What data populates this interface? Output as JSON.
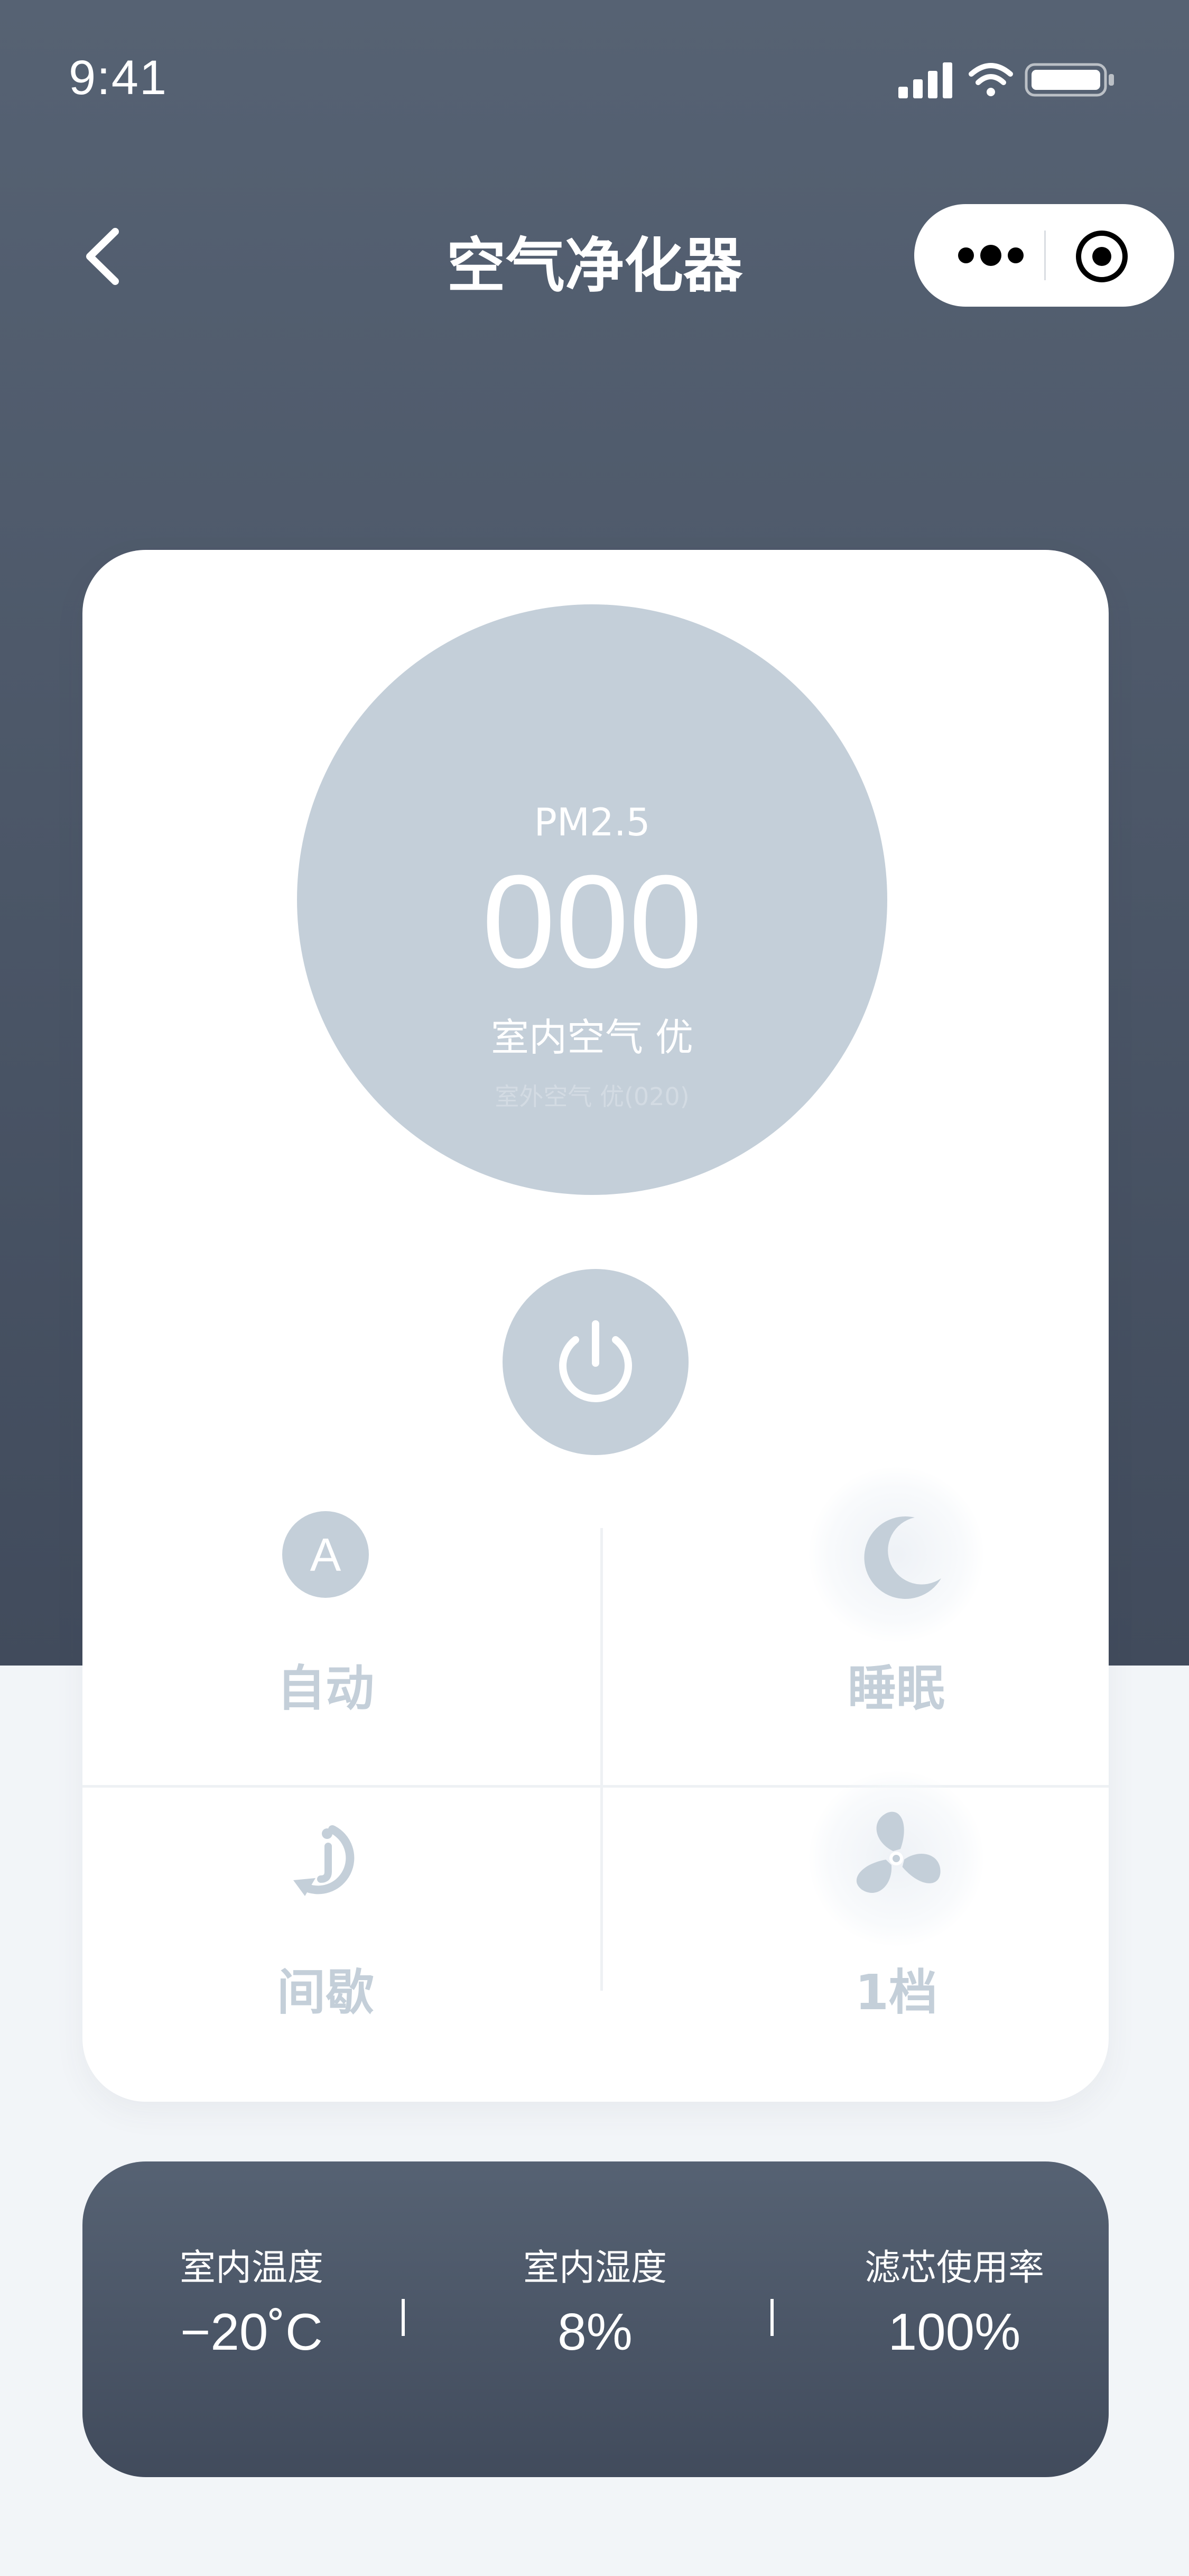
{
  "status_bar": {
    "time": "9:41",
    "icons": [
      "cellular-signal-icon",
      "wifi-icon",
      "battery-icon"
    ]
  },
  "nav": {
    "title": "空气净化器",
    "back_icon": "chevron-left-icon",
    "capsule_icons": [
      "more-icon",
      "target-icon"
    ]
  },
  "air": {
    "label": "PM2.5",
    "value": "000",
    "indoor_quality": "室内空气 优",
    "outdoor_quality": "室外空气 优(020)"
  },
  "power": {
    "icon": "power-icon"
  },
  "modes": [
    {
      "label": "自动",
      "icon": "auto-icon",
      "icon_text": "A"
    },
    {
      "label": "睡眠",
      "icon": "moon-icon"
    },
    {
      "label": "间歇",
      "icon": "timer-icon"
    },
    {
      "label": "1档",
      "icon": "fan-icon"
    }
  ],
  "stats": [
    {
      "label": "室内温度",
      "value": "−20˚C"
    },
    {
      "label": "室内湿度",
      "value": "8%"
    },
    {
      "label": "滤芯使用率",
      "value": "100%"
    }
  ],
  "colors": {
    "header_gradient_top": "#566273",
    "header_gradient_bottom": "#414b5c",
    "accent_grey": "#c4cfd9",
    "page_bg": "#f2f5f8"
  }
}
